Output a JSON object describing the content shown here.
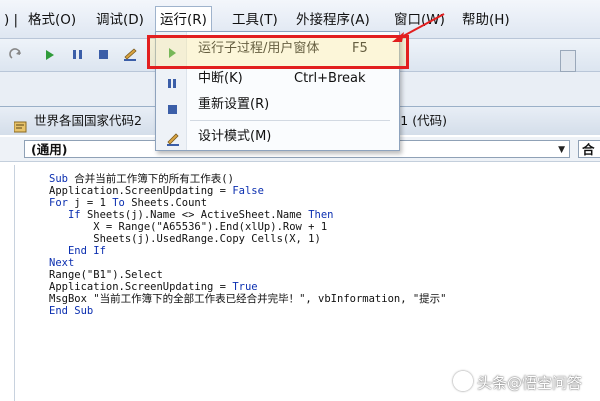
{
  "menubar": {
    "items": [
      {
        "label": ") |"
      },
      {
        "label": "格式(O)"
      },
      {
        "label": "调试(D)"
      },
      {
        "label": "运行(R)"
      },
      {
        "label": "工具(T)"
      },
      {
        "label": "外接程序(A)"
      },
      {
        "label": "窗口(W)"
      },
      {
        "label": "帮助(H)"
      }
    ]
  },
  "run_menu": {
    "items": [
      {
        "label": "运行子过程/用户窗体",
        "shortcut": "F5"
      },
      {
        "label": "中断(K)",
        "shortcut": "Ctrl+Break"
      },
      {
        "label": "重新设置(R)",
        "shortcut": ""
      },
      {
        "label": "设计模式(M)",
        "shortcut": ""
      }
    ]
  },
  "code_window": {
    "title_left": "世界各国国家代码2",
    "title_right": "eet1 (代码)",
    "object_combo": "(通用)",
    "proc_combo": "合",
    "lines": [
      "Sub 合并当前工作簿下的所有工作表()",
      "Application.ScreenUpdating = False",
      "For j = 1 To Sheets.Count",
      "   If Sheets(j).Name <> ActiveSheet.Name Then",
      "       X = Range(\"A65536\").End(xlUp).Row + 1",
      "       Sheets(j).UsedRange.Copy Cells(X, 1)",
      "   End If",
      "Next",
      "Range(\"B1\").Select",
      "Application.ScreenUpdating = True",
      "MsgBox \"当前工作簿下的全部工作表已经合并完毕！\", vbInformation, \"提示\"",
      "End Sub"
    ]
  },
  "watermark": "头条@悟空问答",
  "colors": {
    "highlight_border": "#e21f1f",
    "keyword": "#0b2fb0",
    "run_icon": "#2f9b3a",
    "toolbar_blue": "#3b5ea8"
  }
}
